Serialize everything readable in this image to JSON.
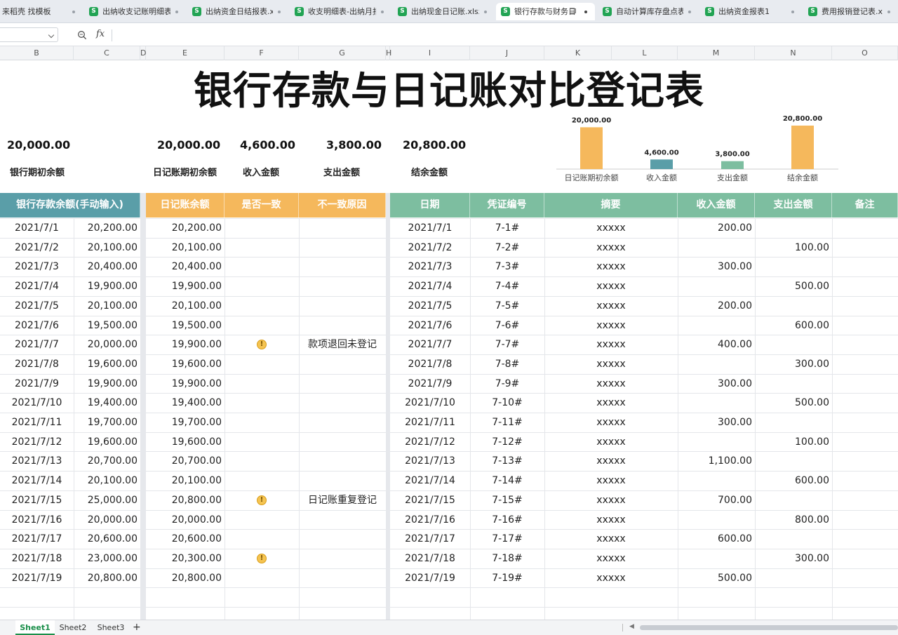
{
  "tabs": [
    {
      "label": "来稻壳 找模板",
      "icon": "",
      "active": false
    },
    {
      "label": "出纳收支记账明细表",
      "icon": "S",
      "active": false
    },
    {
      "label": "出纳资金日结报表.xl",
      "icon": "S",
      "active": false
    },
    {
      "label": "收支明细表-出纳月报",
      "icon": "S",
      "active": false
    },
    {
      "label": "出纳现金日记账.xlsx",
      "icon": "S",
      "active": false
    },
    {
      "label": "银行存款与财务日",
      "icon": "S",
      "active": true
    },
    {
      "label": "自动计算库存盘点表",
      "icon": "S",
      "active": false
    },
    {
      "label": "出纳资金报表1",
      "icon": "S",
      "active": false
    },
    {
      "label": "费用报销登记表.xlsx",
      "icon": "S",
      "active": false
    }
  ],
  "formula_bar": {
    "namebox": "",
    "fx_label": "fx",
    "content": ""
  },
  "columns": [
    "B",
    "C",
    "D",
    "E",
    "F",
    "G",
    "H",
    "I",
    "J",
    "K",
    "L",
    "M",
    "N",
    "O"
  ],
  "sheet": {
    "title": "银行存款与日记账对比登记表",
    "summary": [
      {
        "value": "20,000.00",
        "label": "银行期初余额"
      },
      {
        "value": "20,000.00",
        "label": "日记账期初余额"
      },
      {
        "value": "4,600.00",
        "label": "收入金额"
      },
      {
        "value": "3,800.00",
        "label": "支出金额"
      },
      {
        "value": "20,800.00",
        "label": "结余金额"
      }
    ],
    "left_headers": [
      "银行存款余额(手动输入)",
      "日记账余额",
      "是否一致",
      "不一致原因"
    ],
    "right_headers": [
      "日期",
      "凭证编号",
      "摘要",
      "收入金额",
      "支出金额",
      "备注"
    ],
    "header_colors": {
      "bank": "#5a9ea8",
      "journal": "#f5b85c",
      "detail": "#7dbea0"
    },
    "rows": [
      {
        "date": "2021/7/1",
        "bank": "20,200.00",
        "journal": "20,200.00",
        "warn": false,
        "reason": "",
        "voucher": "7-1#",
        "summary": "xxxxx",
        "income": "200.00",
        "expense": ""
      },
      {
        "date": "2021/7/2",
        "bank": "20,100.00",
        "journal": "20,100.00",
        "warn": false,
        "reason": "",
        "voucher": "7-2#",
        "summary": "xxxxx",
        "income": "",
        "expense": "100.00"
      },
      {
        "date": "2021/7/3",
        "bank": "20,400.00",
        "journal": "20,400.00",
        "warn": false,
        "reason": "",
        "voucher": "7-3#",
        "summary": "xxxxx",
        "income": "300.00",
        "expense": ""
      },
      {
        "date": "2021/7/4",
        "bank": "19,900.00",
        "journal": "19,900.00",
        "warn": false,
        "reason": "",
        "voucher": "7-4#",
        "summary": "xxxxx",
        "income": "",
        "expense": "500.00"
      },
      {
        "date": "2021/7/5",
        "bank": "20,100.00",
        "journal": "20,100.00",
        "warn": false,
        "reason": "",
        "voucher": "7-5#",
        "summary": "xxxxx",
        "income": "200.00",
        "expense": ""
      },
      {
        "date": "2021/7/6",
        "bank": "19,500.00",
        "journal": "19,500.00",
        "warn": false,
        "reason": "",
        "voucher": "7-6#",
        "summary": "xxxxx",
        "income": "",
        "expense": "600.00"
      },
      {
        "date": "2021/7/7",
        "bank": "20,000.00",
        "journal": "19,900.00",
        "warn": true,
        "reason": "款项退回未登记",
        "voucher": "7-7#",
        "summary": "xxxxx",
        "income": "400.00",
        "expense": ""
      },
      {
        "date": "2021/7/8",
        "bank": "19,600.00",
        "journal": "19,600.00",
        "warn": false,
        "reason": "",
        "voucher": "7-8#",
        "summary": "xxxxx",
        "income": "",
        "expense": "300.00"
      },
      {
        "date": "2021/7/9",
        "bank": "19,900.00",
        "journal": "19,900.00",
        "warn": false,
        "reason": "",
        "voucher": "7-9#",
        "summary": "xxxxx",
        "income": "300.00",
        "expense": ""
      },
      {
        "date": "2021/7/10",
        "bank": "19,400.00",
        "journal": "19,400.00",
        "warn": false,
        "reason": "",
        "voucher": "7-10#",
        "summary": "xxxxx",
        "income": "",
        "expense": "500.00"
      },
      {
        "date": "2021/7/11",
        "bank": "19,700.00",
        "journal": "19,700.00",
        "warn": false,
        "reason": "",
        "voucher": "7-11#",
        "summary": "xxxxx",
        "income": "300.00",
        "expense": ""
      },
      {
        "date": "2021/7/12",
        "bank": "19,600.00",
        "journal": "19,600.00",
        "warn": false,
        "reason": "",
        "voucher": "7-12#",
        "summary": "xxxxx",
        "income": "",
        "expense": "100.00"
      },
      {
        "date": "2021/7/13",
        "bank": "20,700.00",
        "journal": "20,700.00",
        "warn": false,
        "reason": "",
        "voucher": "7-13#",
        "summary": "xxxxx",
        "income": "1,100.00",
        "expense": ""
      },
      {
        "date": "2021/7/14",
        "bank": "20,100.00",
        "journal": "20,100.00",
        "warn": false,
        "reason": "",
        "voucher": "7-14#",
        "summary": "xxxxx",
        "income": "",
        "expense": "600.00"
      },
      {
        "date": "2021/7/15",
        "bank": "25,000.00",
        "journal": "20,800.00",
        "warn": true,
        "reason": "日记账重复登记",
        "voucher": "7-15#",
        "summary": "xxxxx",
        "income": "700.00",
        "expense": ""
      },
      {
        "date": "2021/7/16",
        "bank": "20,000.00",
        "journal": "20,000.00",
        "warn": false,
        "reason": "",
        "voucher": "7-16#",
        "summary": "xxxxx",
        "income": "",
        "expense": "800.00"
      },
      {
        "date": "2021/7/17",
        "bank": "20,600.00",
        "journal": "20,600.00",
        "warn": false,
        "reason": "",
        "voucher": "7-17#",
        "summary": "xxxxx",
        "income": "600.00",
        "expense": ""
      },
      {
        "date": "2021/7/18",
        "bank": "23,000.00",
        "journal": "20,300.00",
        "warn": true,
        "reason": "",
        "voucher": "7-18#",
        "summary": "xxxxx",
        "income": "",
        "expense": "300.00"
      },
      {
        "date": "2021/7/19",
        "bank": "20,800.00",
        "journal": "20,800.00",
        "warn": false,
        "reason": "",
        "voucher": "7-19#",
        "summary": "xxxxx",
        "income": "500.00",
        "expense": ""
      }
    ]
  },
  "chart_data": {
    "type": "bar",
    "categories": [
      "日记账期初余额",
      "收入金额",
      "支出金额",
      "结余金额"
    ],
    "values": [
      20000,
      4600,
      3800,
      20800
    ],
    "value_labels": [
      "20,000.00",
      "4,600.00",
      "3,800.00",
      "20,800.00"
    ],
    "colors": [
      "#f5b85c",
      "#5a9ea8",
      "#7dbea0",
      "#f5b85c"
    ],
    "title": "",
    "xlabel": "",
    "ylabel": "",
    "ylim": [
      0,
      20800
    ],
    "grid": false,
    "legend": "none"
  },
  "sheet_tabs": [
    "Sheet1",
    "Sheet2",
    "Sheet3"
  ],
  "active_sheet": "Sheet1",
  "add_sheet_label": "+"
}
